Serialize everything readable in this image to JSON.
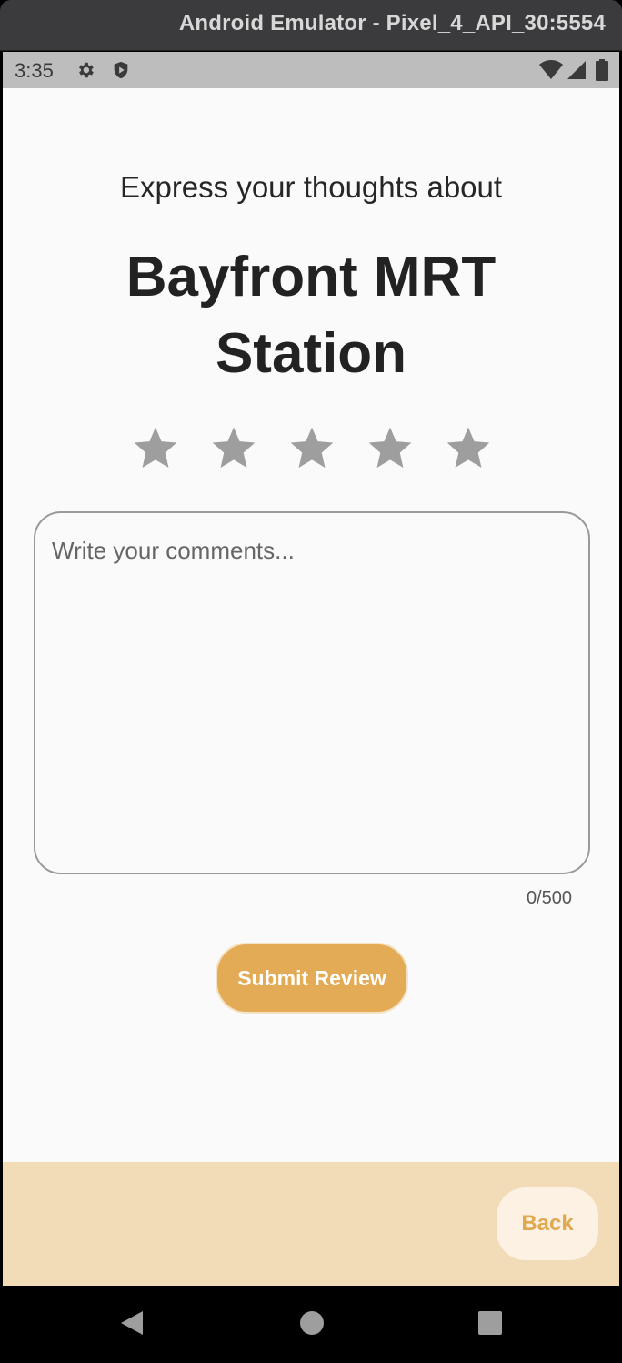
{
  "window": {
    "title": "Android Emulator - Pixel_4_API_30:5554"
  },
  "statusbar": {
    "time": "3:35"
  },
  "review": {
    "prompt": "Express your thoughts about",
    "place_name": "Bayfront MRT Station",
    "rating": {
      "value": 0,
      "max": 5,
      "star_color": "#9e9e9e"
    },
    "comment_placeholder": "Write your comments...",
    "comment_value": "",
    "char_counter": "0/500",
    "submit_label": "Submit Review"
  },
  "bottom": {
    "back_label": "Back"
  },
  "colors": {
    "accent": "#e3ab56",
    "bottom_bar": "#f2dcb8",
    "back_button_bg": "#fcf1e3"
  },
  "navbar": {
    "buttons": [
      "back-icon",
      "home-icon",
      "recents-icon"
    ]
  }
}
